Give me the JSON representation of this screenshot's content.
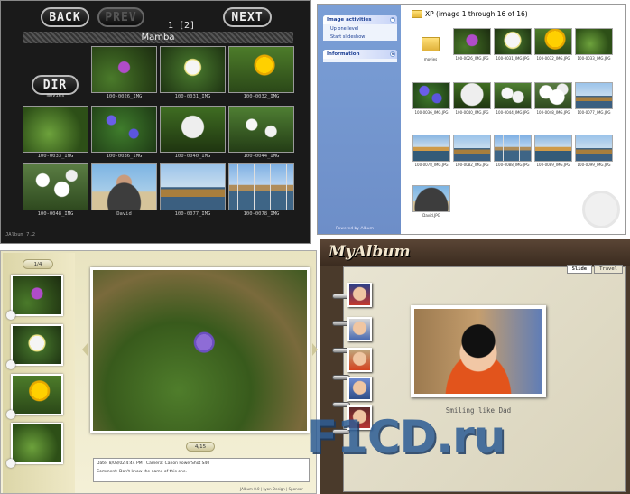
{
  "panel_mamba": {
    "back": "BACK",
    "prev": "PREV",
    "next": "NEXT",
    "dir": "DIR",
    "pager": "1 [2]",
    "title": "Mamba",
    "version": "JAlbum 7.2",
    "captions": [
      "",
      "100-0026_IMG",
      "100-0031_IMG",
      "100-0032_IMG",
      "100-0033_IMG",
      "100-0036_IMG",
      "100-0040_IMG",
      "100-0044_IMG",
      "100-0048_IMG",
      "David",
      "100-0077_IMG",
      "100-0078_IMG"
    ],
    "first_caption": "movies"
  },
  "panel_xp": {
    "task_header": "Image activities",
    "task_items": [
      "Up one level",
      "Start slideshow"
    ],
    "info_header": "Information",
    "folder_title": "XP (image 1 through 16 of 16)",
    "powered": "Powered by",
    "album_name": "Album",
    "items": [
      "movies",
      "100-0026_IMG.JPG",
      "100-0031_IMG.JPG",
      "100-0032_IMG.JPG",
      "100-0033_IMG.JPG",
      "100-0036_IMG.JPG",
      "100-0040_IMG.JPG",
      "100-0044_IMG.JPG",
      "100-0048_IMG.JPG",
      "100-0077_IMG.JPG",
      "100-0078_IMG.JPG",
      "100-0082_IMG.JPG",
      "100-0088_IMG.JPG",
      "100-0089_IMG.JPG",
      "100-0099_IMG.JPG",
      "David.JPG"
    ]
  },
  "panel_green": {
    "thumb_nav": "1/4",
    "image_nav": "4/15",
    "info_line1": "Date: 8/08/02 4:44 PM | Camera: Canon PowerShot S40",
    "info_line2": "Comment: Don't know the name of this one.",
    "footer": "JAlbum 8.0 | Lyon Design | Sponsor"
  },
  "panel_myalbum": {
    "logo": "MyAlbum",
    "tab_slide": "Slide",
    "tab_travel": "Travel",
    "caption": "Smiling like Dad"
  },
  "watermark": "F1CD.ru"
}
